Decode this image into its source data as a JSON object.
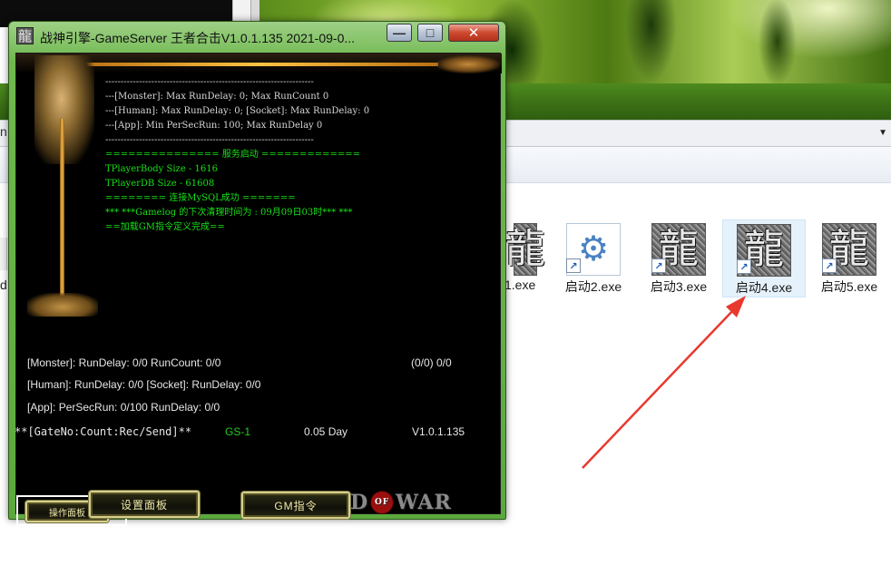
{
  "desktop": {
    "address_left_text": "n",
    "address_dropdown_glyph": "▼",
    "left_cut_label": "d"
  },
  "files": [
    {
      "label": "1.exe",
      "icon": "dragon-glyph-icon",
      "glyph": "龍"
    },
    {
      "label": "启动2.exe",
      "icon": "gear-config-icon",
      "glyph": "⚙"
    },
    {
      "label": "启动3.exe",
      "icon": "dragon-glyph-icon",
      "glyph": "龍"
    },
    {
      "label": "启动4.exe",
      "icon": "dragon-glyph-icon",
      "glyph": "龍",
      "selected": true
    },
    {
      "label": "启动5.exe",
      "icon": "dragon-glyph-icon",
      "glyph": "龍"
    }
  ],
  "shortcut_glyph": "↗",
  "annotation": {
    "color": "#e8392f",
    "shape": "arrow"
  },
  "gameserver": {
    "app_icon_glyph": "龍",
    "title": "战神引擎-GameServer 王者合击V1.0.1.135 2021-09-0...",
    "buttons": {
      "minimize": "—",
      "maximize": "□",
      "close": "✕"
    },
    "log_lines": [
      {
        "text": "--------------------------------------------------------------------",
        "color": "white"
      },
      {
        "text": "---[Monster]: Max RunDelay: 0; Max RunCount 0",
        "color": "white"
      },
      {
        "text": "---[Human]: Max RunDelay: 0; [Socket]: Max RunDelay: 0",
        "color": "white"
      },
      {
        "text": "---[App]: Min PerSecRun: 100; Max RunDelay 0",
        "color": "white"
      },
      {
        "text": "--------------------------------------------------------------------",
        "color": "white"
      },
      {
        "text": "=============== 服务启动 =============",
        "color": "green"
      },
      {
        "text": "TPlayerBody Size - 1616",
        "color": "green"
      },
      {
        "text": "TPlayerDB Size - 61608",
        "color": "green"
      },
      {
        "text": "======== 连接MySQL成功 =======",
        "color": "green"
      },
      {
        "text": "*** ***Gamelog 的下次清理时间为 : 09月09日03时*** ***",
        "color": "green"
      },
      {
        "text": "==加载GM指令定义完成==",
        "color": "green"
      }
    ],
    "status": {
      "monster": "[Monster]: RunDelay: 0/0  RunCount: 0/0",
      "monster_right": "(0/0) 0/0",
      "human": "[Human]: RunDelay: 0/0  [Socket]: RunDelay: 0/0",
      "app": "[App]: PerSecRun: 0/100  RunDelay: 0/0",
      "gate_label": "**[GateNo:Count:Rec/Send]**",
      "gate_value": "GS-1",
      "uptime": "0.05 Day",
      "version": "V1.0.1.135"
    },
    "action_buttons": {
      "operate_panel": "操作面板",
      "settings_panel": "设置面板",
      "gm_command": "GM指令"
    },
    "logo": {
      "left": "D",
      "of": "OF",
      "right": "WAR"
    }
  }
}
